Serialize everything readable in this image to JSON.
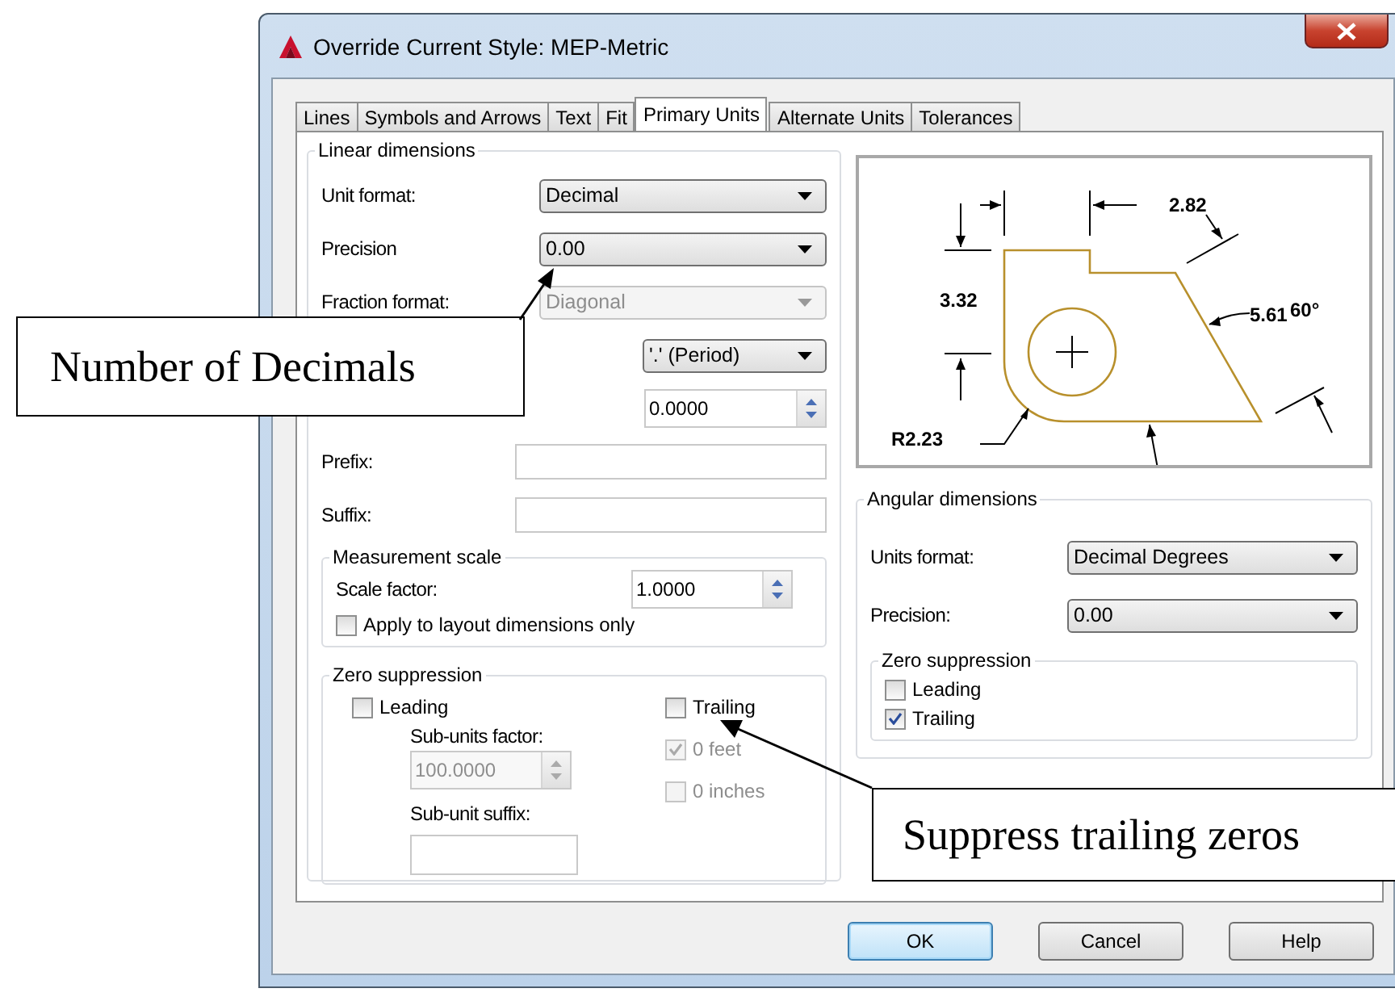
{
  "window": {
    "title": "Override Current Style: MEP-Metric"
  },
  "tabs": [
    {
      "label": "Lines",
      "selected": false
    },
    {
      "label": "Symbols and Arrows",
      "selected": false
    },
    {
      "label": "Text",
      "selected": false
    },
    {
      "label": "Fit",
      "selected": false
    },
    {
      "label": "Primary Units",
      "selected": true
    },
    {
      "label": "Alternate Units",
      "selected": false
    },
    {
      "label": "Tolerances",
      "selected": false
    }
  ],
  "linear_dimensions": {
    "title": "Linear dimensions",
    "fields": [
      {
        "kind": "dropdown",
        "label": "Unit format:",
        "value": "Decimal",
        "disabled": false
      },
      {
        "kind": "dropdown",
        "label": "Precision",
        "value": "0.00",
        "disabled": false
      },
      {
        "kind": "dropdown",
        "label": "Fraction format:",
        "value": "Diagonal",
        "disabled": true
      },
      {
        "kind": "dropdown",
        "value": "'.' (Period)",
        "disabled": false
      },
      {
        "kind": "spinner",
        "value": "0.0000",
        "disabled": false
      },
      {
        "kind": "text",
        "label": "Prefix:",
        "disabled": false
      },
      {
        "kind": "text",
        "label": "Suffix:",
        "disabled": false
      }
    ],
    "measurement_scale": {
      "title": "Measurement scale",
      "scale_label": "Scale factor:",
      "scale_value": "1.0000",
      "layout_only": {
        "label": "Apply to layout dimensions only",
        "checked": false
      }
    },
    "zero_suppression": {
      "title": "Zero suppression",
      "leading": {
        "label": "Leading",
        "checked": false,
        "disabled": false
      },
      "sub_units_factor_label": "Sub-units factor:",
      "sub_units_factor": "100.0000",
      "sub_unit_suffix_label": "Sub-unit suffix:",
      "trailing": {
        "label": "Trailing",
        "checked": false,
        "disabled": false
      },
      "feet": {
        "label": "0 feet",
        "checked": true,
        "disabled": true
      },
      "inches": {
        "label": "0 inches",
        "checked": false,
        "disabled": true
      }
    }
  },
  "preview": {
    "labels": [
      "2.82",
      "3.32",
      "5.61",
      "60°",
      "R2.23"
    ]
  },
  "angular_dimensions": {
    "title": "Angular dimensions",
    "fields": [
      {
        "label": "Units format:",
        "value": "Decimal Degrees"
      },
      {
        "label": "Precision:",
        "value": "0.00"
      }
    ],
    "zero_suppression": {
      "title": "Zero suppression",
      "options": [
        {
          "label": "Leading",
          "checked": false
        },
        {
          "label": "Trailing",
          "checked": true
        }
      ]
    }
  },
  "buttons": [
    {
      "label": "OK",
      "default": true
    },
    {
      "label": "Cancel",
      "default": false
    },
    {
      "label": "Help",
      "default": false
    }
  ],
  "callouts": [
    {
      "text": "Number of Decimals"
    },
    {
      "text": "Suppress trailing zeros"
    }
  ]
}
